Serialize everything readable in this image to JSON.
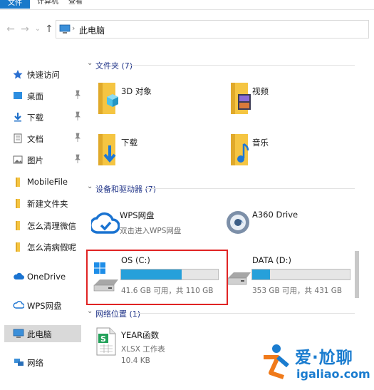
{
  "ribbon": {
    "tabs": [
      "文件",
      "计算机",
      "查看"
    ]
  },
  "address_bar": {
    "path": "此电脑",
    "separator": "›"
  },
  "nav": {
    "back": "←",
    "forward": "→",
    "recent": "⌄",
    "up": "↑"
  },
  "sidebar": {
    "items": [
      {
        "label": "快速访问",
        "icon": "star-icon"
      },
      {
        "label": "桌面",
        "icon": "desktop-icon",
        "pinned": true
      },
      {
        "label": "下载",
        "icon": "download-icon",
        "pinned": true
      },
      {
        "label": "文档",
        "icon": "document-icon",
        "pinned": true
      },
      {
        "label": "图片",
        "icon": "picture-icon",
        "pinned": true
      },
      {
        "label": "MobileFile",
        "icon": "folder-icon"
      },
      {
        "label": "新建文件夹",
        "icon": "folder-icon"
      },
      {
        "label": "怎么清理微信",
        "icon": "folder-icon"
      },
      {
        "label": "怎么清病假呢",
        "icon": "folder-icon"
      },
      {
        "label": "OneDrive",
        "icon": "cloud-icon"
      },
      {
        "label": "WPS网盘",
        "icon": "wps-cloud-icon"
      },
      {
        "label": "此电脑",
        "icon": "computer-icon",
        "selected": true
      },
      {
        "label": "网络",
        "icon": "network-icon"
      }
    ],
    "pin_glyph": "📌"
  },
  "sections": {
    "folders": {
      "title": "文件夹 (7)",
      "chevron": "⌄"
    },
    "devices": {
      "title": "设备和驱动器 (7)",
      "chevron": "⌄"
    },
    "network": {
      "title": "网络位置 (1)",
      "chevron": "⌄"
    }
  },
  "folders": [
    {
      "name": "3D 对象"
    },
    {
      "name": "视频"
    },
    {
      "name": "下载"
    },
    {
      "name": "音乐"
    }
  ],
  "devices": {
    "wps": {
      "name": "WPS网盘",
      "sub": "双击进入WPS网盘"
    },
    "a360": {
      "name": "A360 Drive"
    },
    "c": {
      "name": "OS (C:)",
      "info": "41.6 GB 可用，共 110 GB",
      "used_fraction": 0.622
    },
    "d": {
      "name": "DATA (D:)",
      "info": "353 GB 可用，共 431 GB",
      "used_fraction": 0.181
    }
  },
  "network_item": {
    "name": "YEAR函数",
    "type": "XLSX 工作表",
    "size": "10.4 KB",
    "badge": "S"
  },
  "watermark": {
    "cn": "爱·尬聊",
    "url": "igaliao.com"
  },
  "colors": {
    "accent": "#1979ca",
    "drive_fill": "#26a0da",
    "highlight": "#e02424",
    "section_text": "#1e3287",
    "folder_yellow": "#f5c542",
    "watermark": "#1a7ccf"
  }
}
